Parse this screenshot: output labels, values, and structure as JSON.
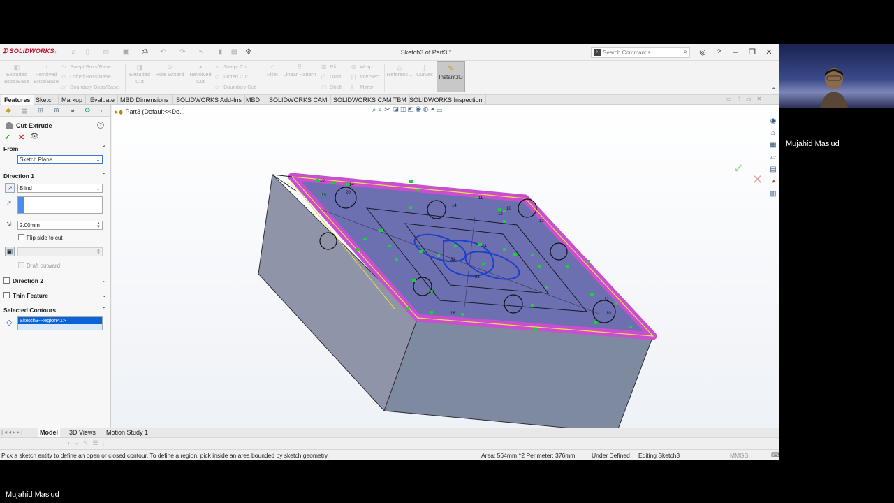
{
  "window": {
    "title": "Sketch3 of Part3 *",
    "app_logo": "SOLIDWORKS",
    "search_placeholder": "Search Commands"
  },
  "command_manager": {
    "items": [
      {
        "label": "Extruded Boss/Base"
      },
      {
        "label": "Revolved Boss/Base"
      },
      {
        "label": "Swept Boss/Base"
      },
      {
        "label": "Lofted Boss/Base"
      },
      {
        "label": "Boundary Boss/Base"
      },
      {
        "label": "Extruded Cut"
      },
      {
        "label": "Hole Wizard"
      },
      {
        "label": "Revolved Cut"
      },
      {
        "label": "Swept Cut"
      },
      {
        "label": "Lofted Cut"
      },
      {
        "label": "Boundary Cut"
      },
      {
        "label": "Fillet"
      },
      {
        "label": "Linear Pattern"
      },
      {
        "label": "Rib"
      },
      {
        "label": "Draft"
      },
      {
        "label": "Shell"
      },
      {
        "label": "Wrap"
      },
      {
        "label": "Intersect"
      },
      {
        "label": "Mirror"
      },
      {
        "label": "Referenc..."
      },
      {
        "label": "Curves"
      },
      {
        "label": "Instant3D"
      }
    ]
  },
  "tabs": [
    "Features",
    "Sketch",
    "Markup",
    "Evaluate",
    "MBD Dimensions",
    "SOLIDWORKS Add-Ins",
    "MBD",
    "SOLIDWORKS CAM",
    "SOLIDWORKS CAM TBM",
    "SOLIDWORKS Inspection"
  ],
  "property_manager": {
    "title": "Cut-Extrude",
    "from_label": "From",
    "from_value": "Sketch Plane",
    "direction1_label": "Direction 1",
    "end_condition": "Blind",
    "depth": "2.00mm",
    "flip_side_label": "Flip side to cut",
    "draft_outward_label": "Draft outward",
    "direction2_label": "Direction 2",
    "thin_feature_label": "Thin Feature",
    "selected_contours_label": "Selected Contours",
    "contour_item": "Sketch3-Region<1>"
  },
  "breadcrumb": "Part3  (Default<<De...",
  "bottom_tabs": [
    "Model",
    "3D Views",
    "Motion Study 1"
  ],
  "status": {
    "message": "Pick a sketch entity to define an open or closed contour. To define a region, pick inside an area bounded by sketch geometry.",
    "area": "Area: 564mm ^2 Perimeter: 376mm",
    "definition": "Under Defined",
    "editing": "Editing Sketch3",
    "units": "MMGS"
  },
  "video": {
    "speaker_name": "Mujahid Mas'ud",
    "self_name": "Mujahid Mas'ud"
  },
  "colors": {
    "accent_magenta": "#c94fd0",
    "sketch_green": "#1fcf3a",
    "contour_blue": "#1c3fd0",
    "selection_blue": "#0a64d8"
  }
}
